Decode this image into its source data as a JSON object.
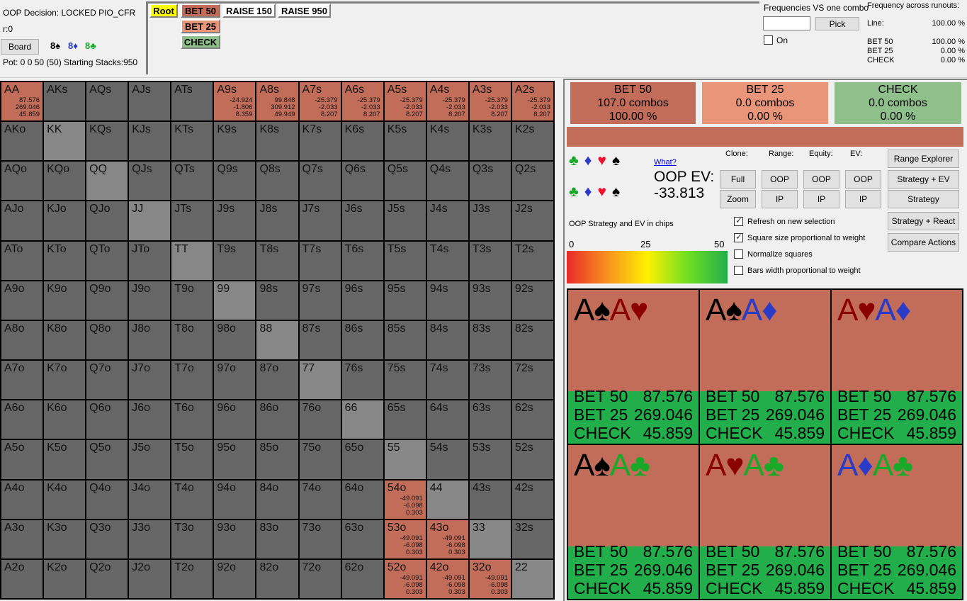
{
  "info": {
    "decision": "OOP Decision:  LOCKED PIO_CFR",
    "r": "r:0",
    "board_button": "Board",
    "board_cards": [
      {
        "rank": "8",
        "suit": "♠",
        "color": "#000000"
      },
      {
        "rank": "8",
        "suit": "♦",
        "color": "#2a3bc8"
      },
      {
        "rank": "8",
        "suit": "♣",
        "color": "#18a928"
      }
    ],
    "pot": "Pot: 0 0 50 (50) Starting Stacks:950"
  },
  "tree": {
    "nodes": [
      {
        "label": "Root",
        "color": "#ffff00"
      },
      {
        "label": "BET 50",
        "color": "#c26d5a"
      },
      {
        "label": "RAISE 150",
        "color": "#ffffff"
      },
      {
        "label": "RAISE 950",
        "color": "#ffffff"
      },
      {
        "label": "BET 25",
        "color": "#e8957a"
      },
      {
        "label": "CHECK",
        "color": "#8fbf8b"
      }
    ]
  },
  "freq_one": {
    "title": "Frequencies VS one combo",
    "input_value": "",
    "pick_button": "Pick",
    "on_label": "On",
    "on_checked": false
  },
  "freq_runouts": {
    "title": "Frequency across runouts:",
    "line_label": "Line:",
    "line_value": "100.00 %",
    "rows": [
      {
        "label": "BET 50",
        "value": "100.00 %"
      },
      {
        "label": "BET 25",
        "value": "0.00 %"
      },
      {
        "label": "CHECK",
        "value": "0.00 %"
      }
    ]
  },
  "grid": {
    "ranks": [
      "A",
      "K",
      "Q",
      "J",
      "T",
      "9",
      "8",
      "7",
      "6",
      "5",
      "4",
      "3",
      "2"
    ],
    "colors": {
      "default": "#666666",
      "pair": "#878787",
      "bet": "#c26d5a"
    },
    "highlighted": {
      "AA": [
        "87.576",
        "269.046",
        "45.859"
      ],
      "A9s": [
        "-24.924",
        "-1.806",
        "8.359"
      ],
      "A8s": [
        "99.848",
        "309.912",
        "49.949"
      ],
      "A7s": [
        "-25.379",
        "-2.033",
        "8.207"
      ],
      "A6s": [
        "-25.379",
        "-2.033",
        "8.207"
      ],
      "A5s": [
        "-25.379",
        "-2.033",
        "8.207"
      ],
      "A4s": [
        "-25.379",
        "-2.033",
        "8.207"
      ],
      "A3s": [
        "-25.379",
        "-2.033",
        "8.207"
      ],
      "A2s": [
        "-25.379",
        "-2.033",
        "8.207"
      ],
      "54o": [
        "-49.091",
        "-6.098",
        "0.303"
      ],
      "53o": [
        "-49.091",
        "-6.098",
        "0.303"
      ],
      "43o": [
        "-49.091",
        "-6.098",
        "0.303"
      ],
      "52o": [
        "-49.091",
        "-6.098",
        "0.303"
      ],
      "42o": [
        "-49.091",
        "-6.098",
        "0.303"
      ],
      "32o": [
        "-49.091",
        "-6.098",
        "0.303"
      ]
    }
  },
  "actions": [
    {
      "name": "BET 50",
      "combos": "107.0 combos",
      "pct": "100.00 %",
      "color": "#c26d5a"
    },
    {
      "name": "BET 25",
      "combos": "0.0 combos",
      "pct": "0.00 %",
      "color": "#e8957a"
    },
    {
      "name": "CHECK",
      "combos": "0.0 combos",
      "pct": "0.00 %",
      "color": "#8fbf8b"
    }
  ],
  "strategy_bar": {
    "color": "#c26d5a",
    "bet50_fraction": 1.0
  },
  "suit_filters": {
    "row1": [
      {
        "suit": "♣",
        "color": "#18a928"
      },
      {
        "suit": "♦",
        "color": "#2a3bc8"
      },
      {
        "suit": "♥",
        "color": "#f0102a"
      },
      {
        "suit": "♠",
        "color": "#000000"
      }
    ],
    "row2": [
      {
        "suit": "♣",
        "color": "#18a928"
      },
      {
        "suit": "♦",
        "color": "#2a3bc8"
      },
      {
        "suit": "♥",
        "color": "#f0102a"
      },
      {
        "suit": "♠",
        "color": "#000000"
      }
    ]
  },
  "what_link": "What?",
  "ev": {
    "label": "OOP EV:",
    "value": "-33.813"
  },
  "legend": {
    "title": "OOP Strategy and EV in chips",
    "min": "0",
    "mid": "25",
    "max": "50"
  },
  "controls": {
    "headers": {
      "clone": "Clone:",
      "range": "Range:",
      "equity": "Equity:",
      "ev": "EV:"
    },
    "clone_full": "Full",
    "clone_zoom": "Zoom",
    "range_oop": "OOP",
    "range_ip": "IP",
    "equity_oop": "OOP",
    "equity_ip": "IP",
    "ev_oop": "OOP",
    "ev_ip": "IP",
    "range_explorer": "Range Explorer",
    "strategy_ev": "Strategy + EV",
    "strategy": "Strategy",
    "strategy_react": "Strategy + React",
    "compare_actions": "Compare Actions",
    "options": [
      {
        "label": "Refresh on new selection",
        "checked": true
      },
      {
        "label": "Square size proportional to weight",
        "checked": true
      },
      {
        "label": "Normalize squares",
        "checked": false
      },
      {
        "label": "Bars width proportional to weight",
        "checked": false
      }
    ]
  },
  "combos": [
    {
      "cards": [
        {
          "r": "A",
          "s": "♠",
          "c": "#000000"
        },
        {
          "r": "A",
          "s": "♥",
          "c": "#8b0000"
        }
      ],
      "rows": [
        [
          "BET 50",
          "87.576"
        ],
        [
          "BET 25",
          "269.046"
        ],
        [
          "CHECK",
          "45.859"
        ]
      ]
    },
    {
      "cards": [
        {
          "r": "A",
          "s": "♠",
          "c": "#000000"
        },
        {
          "r": "A",
          "s": "♦",
          "c": "#2a3bc8"
        }
      ],
      "rows": [
        [
          "BET 50",
          "87.576"
        ],
        [
          "BET 25",
          "269.046"
        ],
        [
          "CHECK",
          "45.859"
        ]
      ]
    },
    {
      "cards": [
        {
          "r": "A",
          "s": "♥",
          "c": "#8b0000"
        },
        {
          "r": "A",
          "s": "♦",
          "c": "#2a3bc8"
        }
      ],
      "rows": [
        [
          "BET 50",
          "87.576"
        ],
        [
          "BET 25",
          "269.046"
        ],
        [
          "CHECK",
          "45.859"
        ]
      ]
    },
    {
      "cards": [
        {
          "r": "A",
          "s": "♠",
          "c": "#000000"
        },
        {
          "r": "A",
          "s": "♣",
          "c": "#18a928"
        }
      ],
      "rows": [
        [
          "BET 50",
          "87.576"
        ],
        [
          "BET 25",
          "269.046"
        ],
        [
          "CHECK",
          "45.859"
        ]
      ]
    },
    {
      "cards": [
        {
          "r": "A",
          "s": "♥",
          "c": "#8b0000"
        },
        {
          "r": "A",
          "s": "♣",
          "c": "#18a928"
        }
      ],
      "rows": [
        [
          "BET 50",
          "87.576"
        ],
        [
          "BET 25",
          "269.046"
        ],
        [
          "CHECK",
          "45.859"
        ]
      ]
    },
    {
      "cards": [
        {
          "r": "A",
          "s": "♦",
          "c": "#2a3bc8"
        },
        {
          "r": "A",
          "s": "♣",
          "c": "#18a928"
        }
      ],
      "rows": [
        [
          "BET 50",
          "87.576"
        ],
        [
          "BET 25",
          "269.046"
        ],
        [
          "CHECK",
          "45.859"
        ]
      ]
    }
  ]
}
